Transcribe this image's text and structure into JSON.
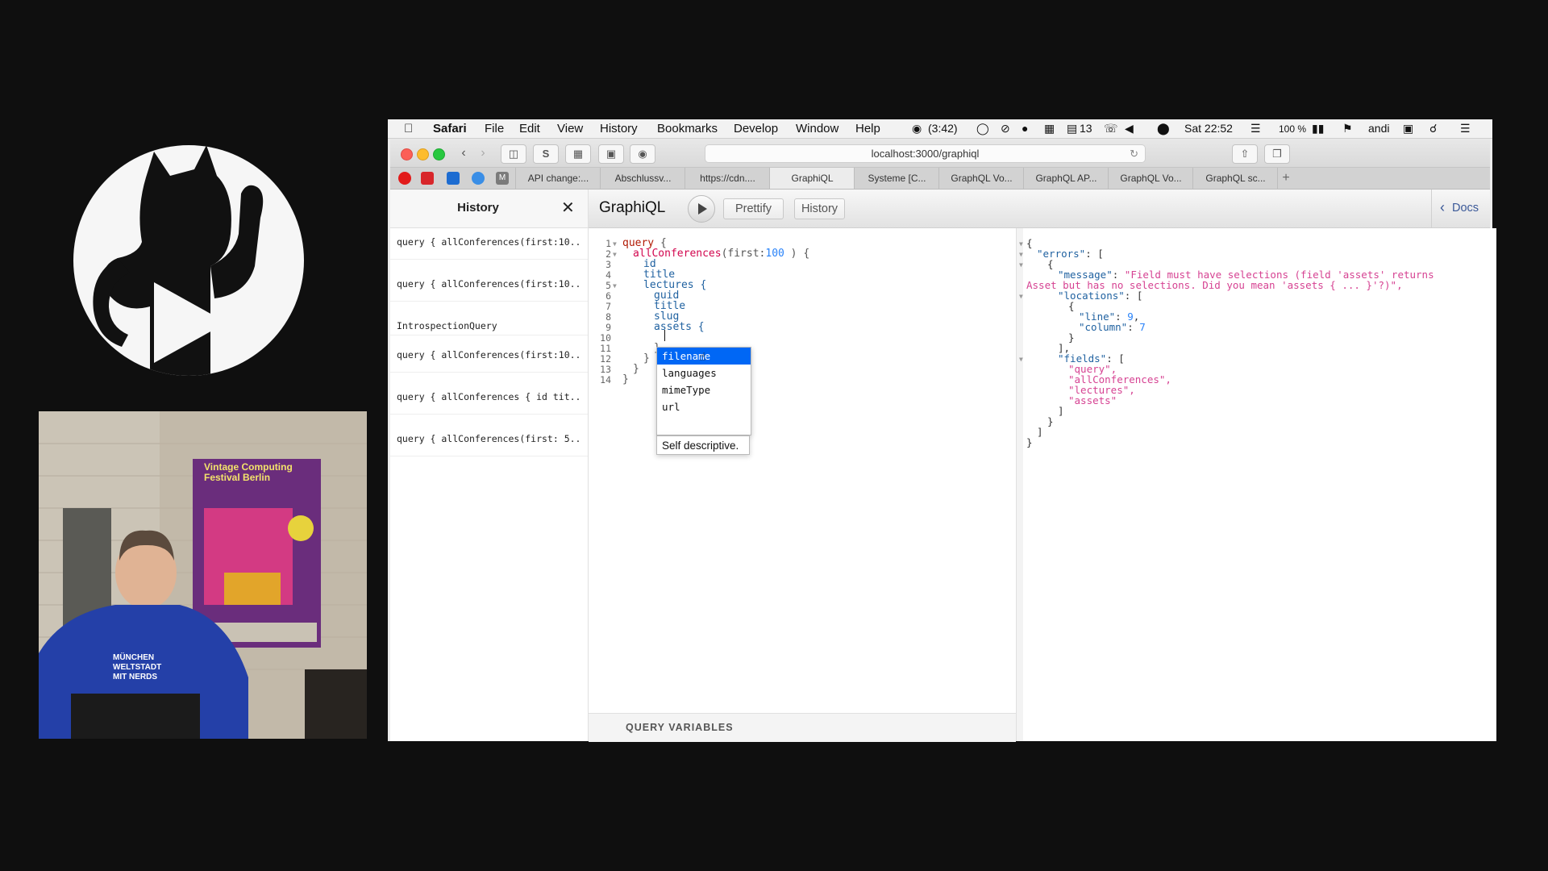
{
  "menubar": {
    "app": "Safari",
    "items": [
      "File",
      "Edit",
      "View",
      "History",
      "Bookmarks",
      "Develop",
      "Window",
      "Help"
    ],
    "timer": "(3:42)",
    "badge_count": "13",
    "battery": "100 %",
    "clock": "Sat 22:52",
    "user": "andi"
  },
  "browser": {
    "url": "localhost:3000/graphiql",
    "tabs": [
      "API change:...",
      "Abschlussv...",
      "https://cdn....",
      "GraphiQL",
      "Systeme [C...",
      "GraphQL Vo...",
      "GraphQL AP...",
      "GraphQL Vo...",
      "GraphQL sc..."
    ],
    "active_tab": "GraphiQL",
    "reader_label": "S"
  },
  "graphiql": {
    "history_title": "History",
    "history_items": [
      "query { allConferences(first:10...",
      "query { allConferences(first:10...",
      "IntrospectionQuery",
      "query { allConferences(first:10...",
      "query { allConferences { id tit...",
      "query { allConferences(first: 5..."
    ],
    "logo": "GraphiQL",
    "prettify_label": "Prettify",
    "history_label": "History",
    "docs_label": "Docs",
    "line_numbers": [
      "1",
      "2",
      "3",
      "4",
      "5",
      "6",
      "7",
      "8",
      "9",
      "10",
      "11",
      "12",
      "13",
      "14"
    ],
    "query_variables_label": "QUERY VARIABLES",
    "autocomplete": {
      "items": [
        "filename",
        "languages",
        "mimeType",
        "url"
      ],
      "selected": "filename",
      "hint": "Self descriptive."
    },
    "code": {
      "l1_kw": "query",
      "l1_rest": " {",
      "l2_def": "allConferences",
      "l2_arg": "(first:",
      "l2_num": "100",
      "l2_rest": " ) {",
      "l3": "id",
      "l4": "title",
      "l5": "lectures {",
      "l6": "guid",
      "l7": "title",
      "l8": "slug",
      "l9": "assets {",
      "l11": "}",
      "l12": "}",
      "l13": "}",
      "l14": "}"
    },
    "result": {
      "l1": "{",
      "errors_key": "\"errors\"",
      "brace": "{",
      "message_key": "\"message\"",
      "message_1": "\"Field must have selections (field 'assets' returns",
      "message_2": "Asset but has no selections. Did you mean 'assets { ... }'?)\",",
      "locations_key": "\"locations\"",
      "line_key": "\"line\"",
      "line_val": "9",
      "column_key": "\"column\"",
      "column_val": "7",
      "fields_key": "\"fields\"",
      "field_1": "\"query\",",
      "field_2": "\"allConferences\",",
      "field_3": "\"lectures\",",
      "field_4": "\"assets\""
    }
  },
  "video": {
    "poster_title": "Vintage Computing Festival Berlin",
    "shirt_text": "MÜNCHEN WELTSTADT MIT NERDS"
  },
  "colors": {
    "selection": "#0067f5",
    "keyword": "#b11a04",
    "definition": "#d2054e",
    "property": "#1f61a0",
    "string": "#d64292",
    "number": "#2882f9"
  }
}
